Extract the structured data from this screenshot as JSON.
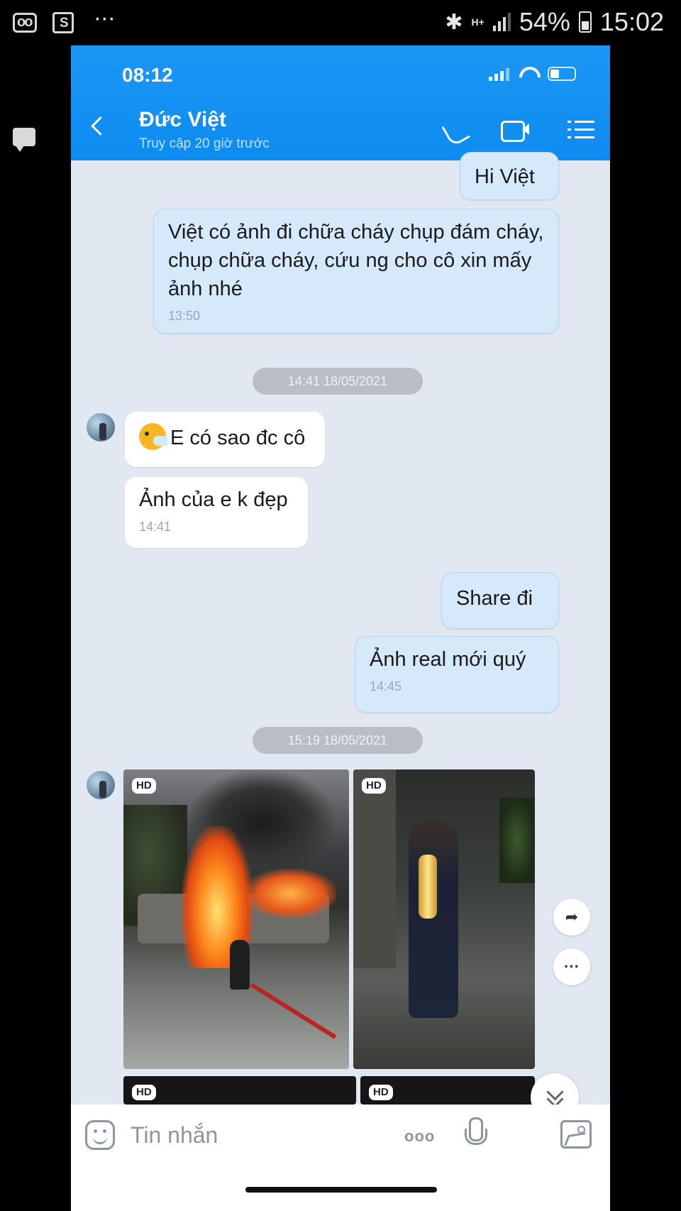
{
  "outer_status": {
    "battery": "54%",
    "time": "15:02",
    "network": "H+",
    "more": "···"
  },
  "app": {
    "inner_time": "08:12",
    "contact_name": "Đức Việt",
    "contact_status": "Truy cập 20 giờ trước"
  },
  "messages": {
    "m1": {
      "text": "Hi Việt"
    },
    "m2": {
      "text": "Việt có ảnh đi chữa cháy chụp đám cháy,  chụp chữa cháy, cứu ng cho cô xin mấy ảnh nhé",
      "time": "13:50"
    },
    "date1": "14:41 18/05/2021",
    "m3": {
      "text": "E có sao đc cô"
    },
    "m4": {
      "text": "Ảnh của e k đẹp",
      "time": "14:41"
    },
    "m5": {
      "text": "Share đi"
    },
    "m6": {
      "text": "Ảnh real mới quý",
      "time": "14:45"
    },
    "date2": "15:19 18/05/2021",
    "photo_badges": [
      "HD",
      "HD",
      "HD",
      "HD"
    ]
  },
  "side_actions": {
    "share_glyph": "➦",
    "more_glyph": "···"
  },
  "input": {
    "placeholder": "Tin nhắn",
    "more_dots": "ooo"
  },
  "colors": {
    "header": "#0d8bf0",
    "my_bubble": "#d5e9fb",
    "chat_bg": "#e2e8f1"
  }
}
